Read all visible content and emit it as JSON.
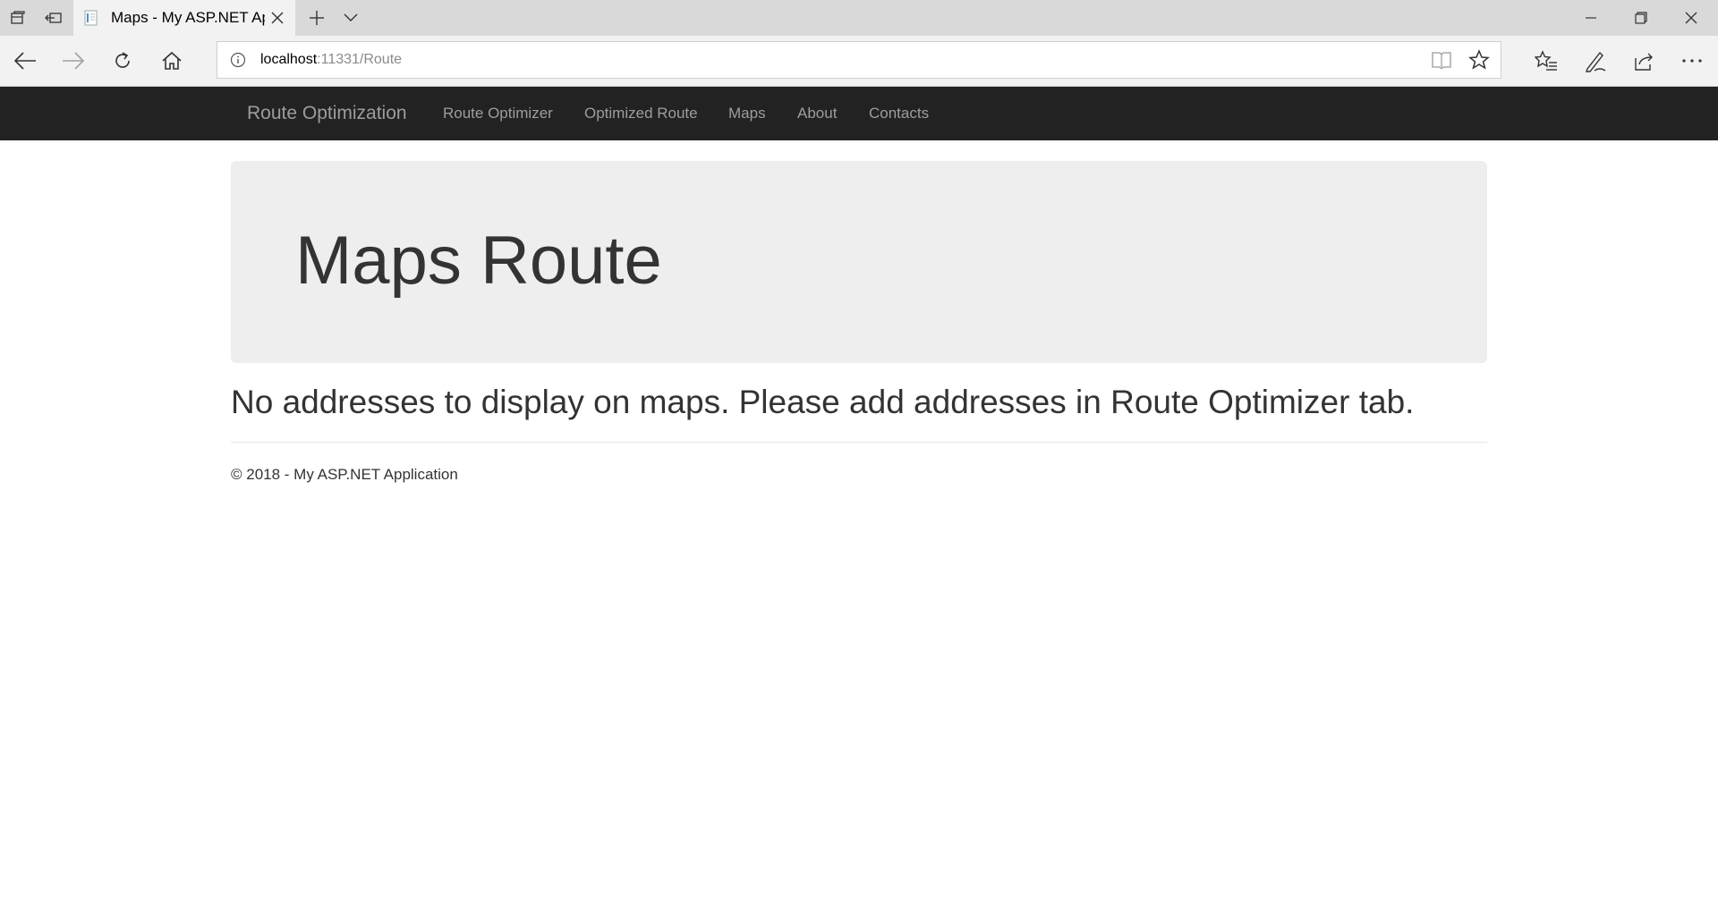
{
  "browser": {
    "tab_title": "Maps - My ASP.NET Ap",
    "url_host": "localhost",
    "url_path": ":11331/Route"
  },
  "site": {
    "brand": "Route Optimization",
    "nav": [
      "Route Optimizer",
      "Optimized Route",
      "Maps",
      "About",
      "Contacts"
    ]
  },
  "page": {
    "heading": "Maps Route",
    "message": "No addresses to display on maps. Please add addresses in Route Optimizer tab.",
    "footer": "© 2018 - My ASP.NET Application"
  },
  "colors": {
    "navbar_bg": "#222222",
    "nav_text": "#9d9d9d",
    "jumbotron_bg": "#eeeeee",
    "text": "#333333"
  }
}
